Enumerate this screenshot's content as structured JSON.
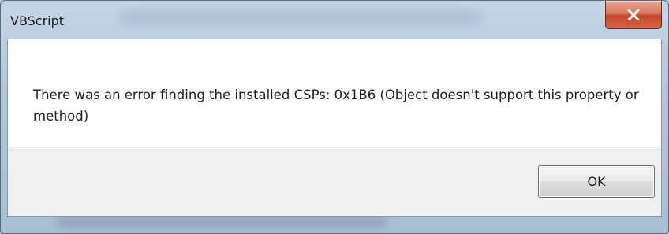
{
  "window": {
    "title": "VBScript",
    "close_icon": "close-x-icon"
  },
  "dialog": {
    "message": "There was an error finding the installed CSPs: 0x1B6 (Object doesn't support this property or method)",
    "ok_label": "OK"
  },
  "colors": {
    "close_button": "#c4452a",
    "client_background": "#ffffff",
    "footer_background": "#f0f0f0"
  }
}
